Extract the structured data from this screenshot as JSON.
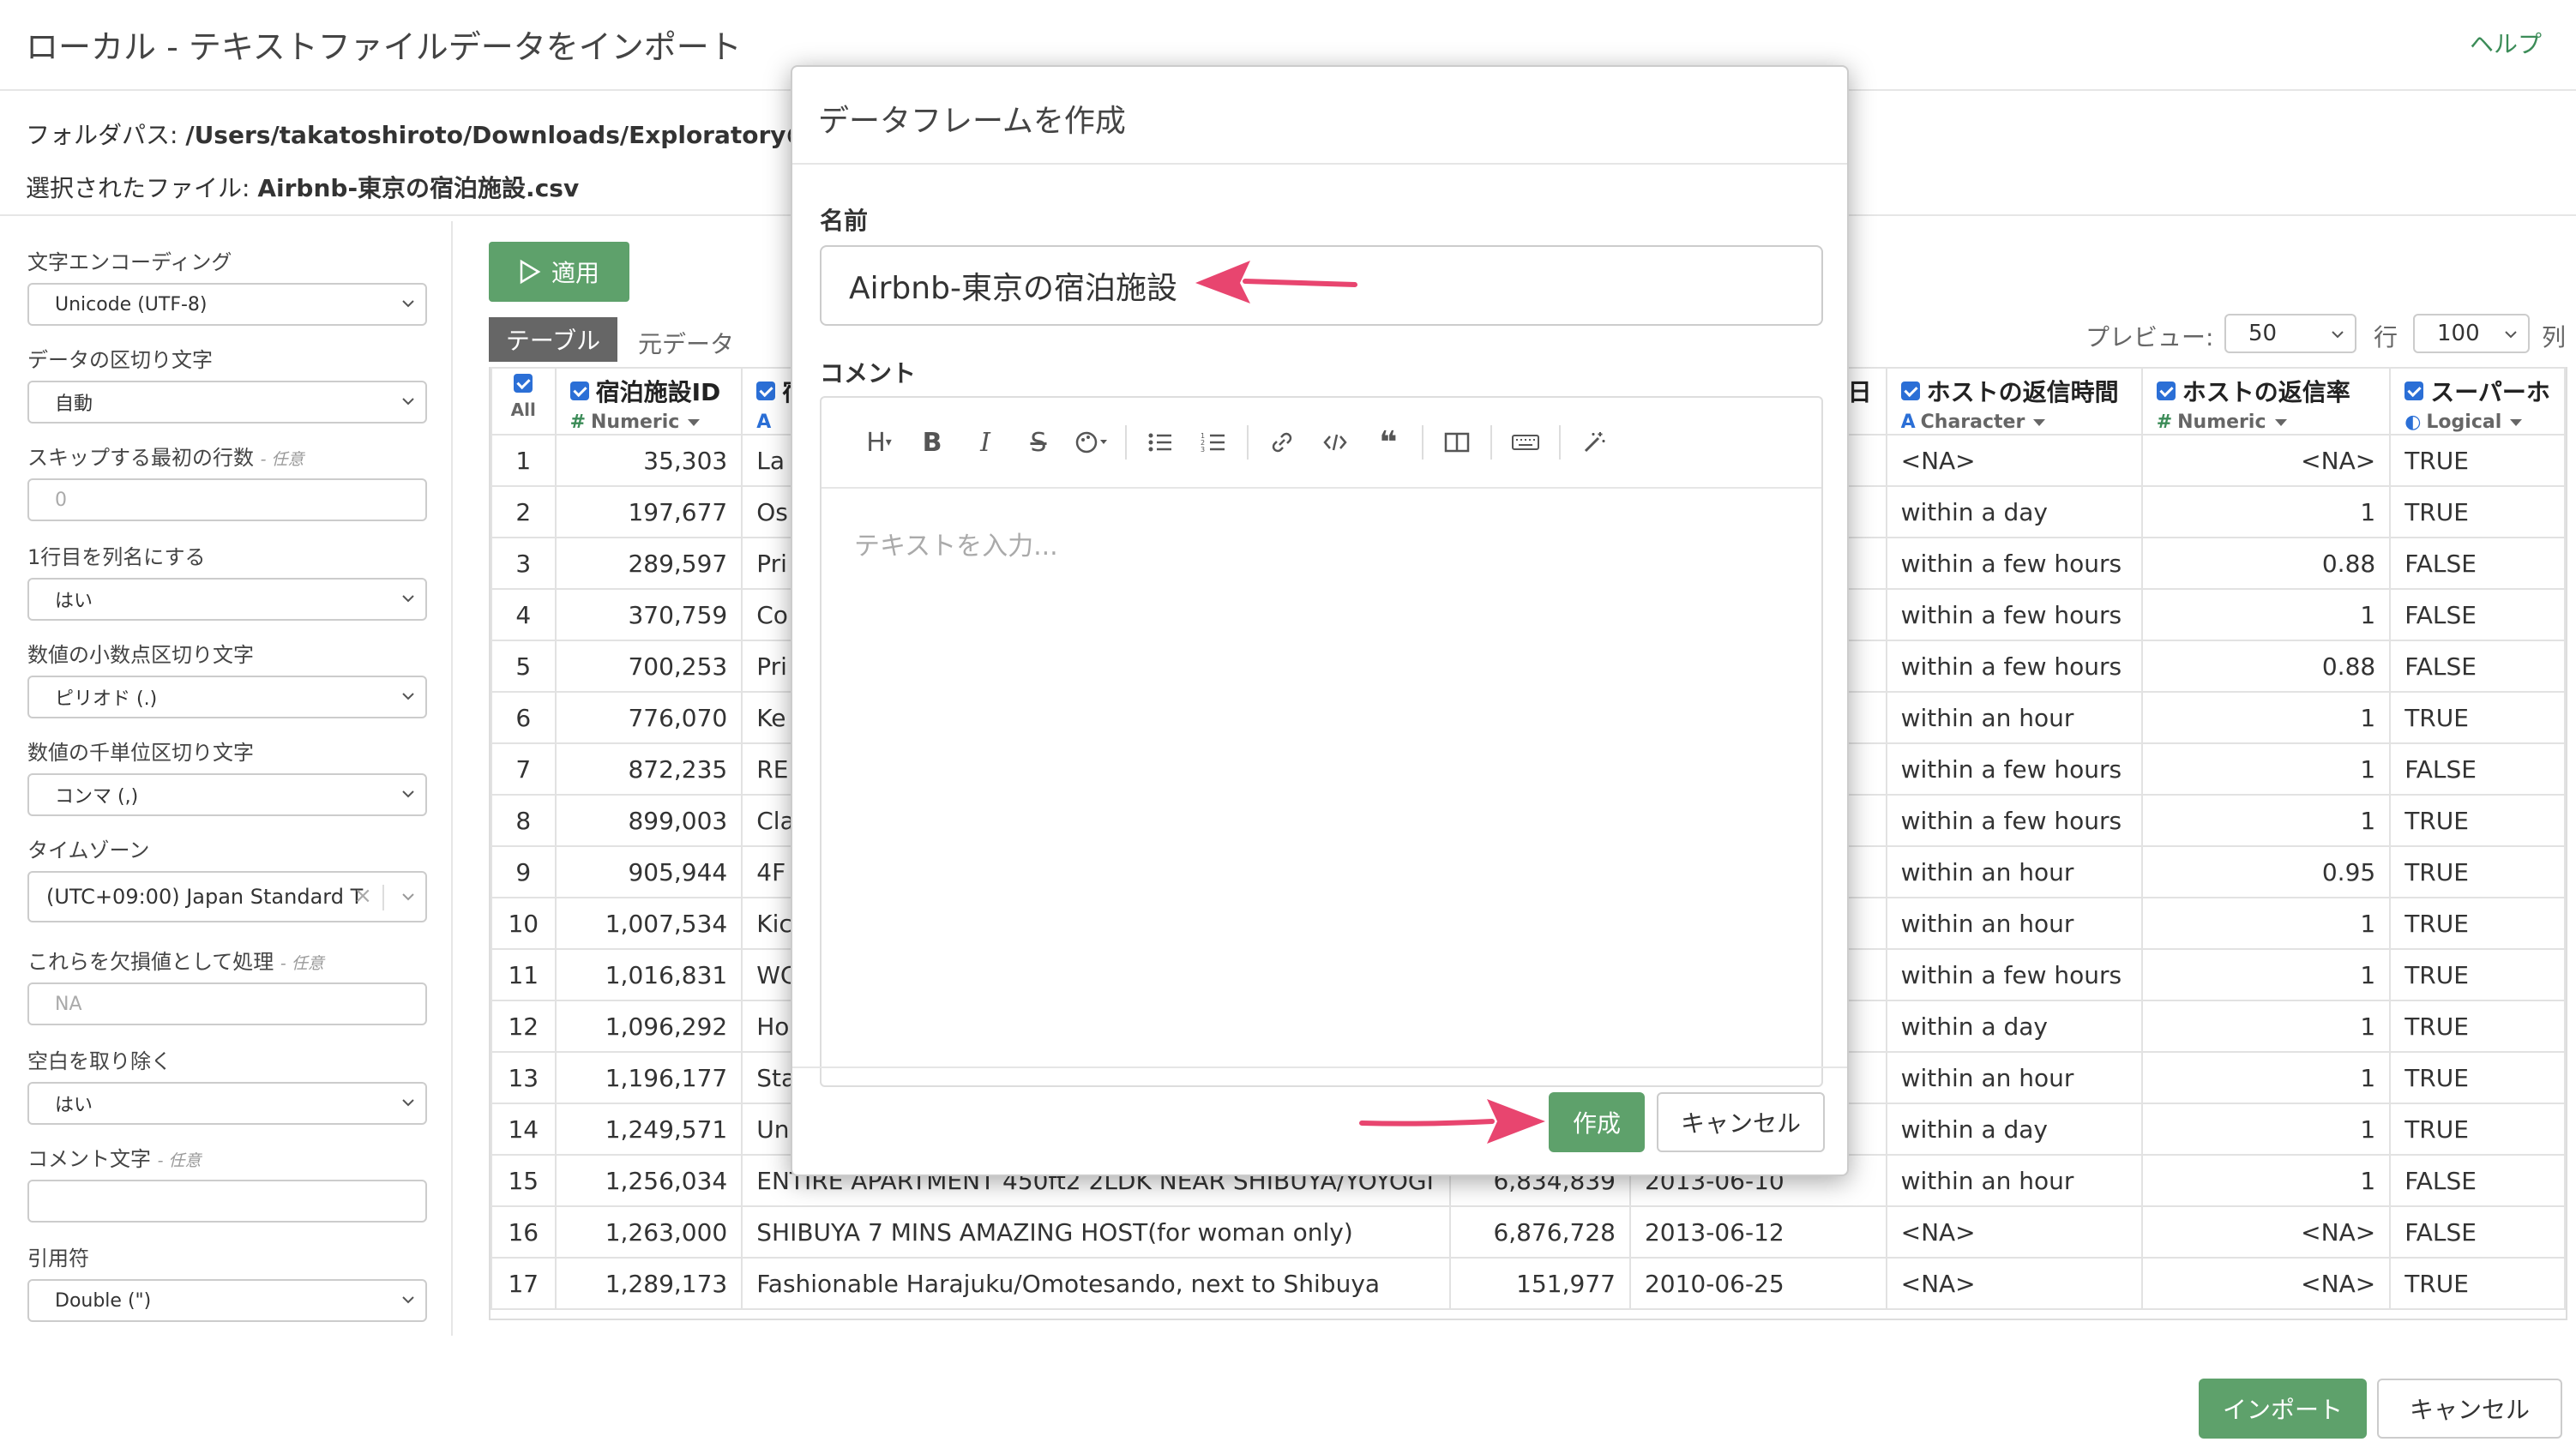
{
  "header": {
    "title": "ローカル - テキストファイルデータをインポート",
    "help_label": "ヘルプ"
  },
  "info": {
    "folder_label": "フォルダパス:",
    "folder_value": "/Users/takatoshiroto/Downloads/Exploratoryの使い",
    "file_label": "選択されたファイル:",
    "file_value": "Airbnb-東京の宿泊施設.csv"
  },
  "sidebar": {
    "encoding": {
      "label": "文字エンコーディング",
      "value": "Unicode (UTF-8)"
    },
    "delimiter": {
      "label": "データの区切り文字",
      "value": "自動"
    },
    "skip_rows": {
      "label": "スキップする最初の行数",
      "optional": "- 任意",
      "placeholder": "0"
    },
    "header_row": {
      "label": "1行目を列名にする",
      "value": "はい"
    },
    "decimal_mark": {
      "label": "数値の小数点区切り文字",
      "value": "ピリオド (.)"
    },
    "grouping_mark": {
      "label": "数値の千単位区切り文字",
      "value": "コンマ (,)"
    },
    "timezone": {
      "label": "タイムゾーン",
      "value": "(UTC+09:00) Japan Standard T",
      "clear": "×"
    },
    "na_values": {
      "label": "これらを欠損値として処理",
      "optional": "- 任意",
      "placeholder": "NA"
    },
    "trim_ws": {
      "label": "空白を取り除く",
      "value": "はい"
    },
    "comment_char": {
      "label": "コメント文字",
      "optional": "- 任意",
      "value": ""
    },
    "quote": {
      "label": "引用符",
      "value": "Double (\")"
    }
  },
  "toolbar": {
    "apply_label": "適用",
    "tab_table": "テーブル",
    "tab_raw": "元データ",
    "preview_label": "プレビュー:",
    "rows_value": "50",
    "rows_label": "行",
    "cols_value": "100",
    "cols_label": "列"
  },
  "table": {
    "all_label": "All",
    "columns": [
      {
        "name": "宿泊施設ID",
        "type": "Numeric"
      },
      {
        "name": "宿",
        "type": ""
      },
      {
        "name": "",
        "type": ""
      },
      {
        "name": "開始日",
        "type": ""
      },
      {
        "name": "ホストの返信時間",
        "type": "Character"
      },
      {
        "name": "ホストの返信率",
        "type": "Numeric"
      },
      {
        "name": "スーパーホ",
        "type": "Logical"
      }
    ],
    "rows": [
      [
        "1",
        "35,303",
        "La",
        "",
        "",
        "<NA>",
        "<NA>",
        "TRUE"
      ],
      [
        "2",
        "197,677",
        "Os",
        "",
        "",
        "within a day",
        "1",
        "TRUE"
      ],
      [
        "3",
        "289,597",
        "Pri",
        "",
        "",
        "within a few hours",
        "0.88",
        "FALSE"
      ],
      [
        "4",
        "370,759",
        "Co",
        "",
        "",
        "within a few hours",
        "1",
        "FALSE"
      ],
      [
        "5",
        "700,253",
        "Pri",
        "",
        "",
        "within a few hours",
        "0.88",
        "FALSE"
      ],
      [
        "6",
        "776,070",
        "Ke",
        "",
        "",
        "within an hour",
        "1",
        "TRUE"
      ],
      [
        "7",
        "872,235",
        "RE",
        "",
        "",
        "within a few hours",
        "1",
        "FALSE"
      ],
      [
        "8",
        "899,003",
        "Cla",
        "",
        "",
        "within a few hours",
        "1",
        "TRUE"
      ],
      [
        "9",
        "905,944",
        "4F",
        "",
        "",
        "within an hour",
        "0.95",
        "TRUE"
      ],
      [
        "10",
        "1,007,534",
        "Kic",
        "",
        "",
        "within an hour",
        "1",
        "TRUE"
      ],
      [
        "11",
        "1,016,831",
        "WC",
        "",
        "",
        "within a few hours",
        "1",
        "TRUE"
      ],
      [
        "12",
        "1,096,292",
        "Ho",
        "",
        "",
        "within a day",
        "1",
        "TRUE"
      ],
      [
        "13",
        "1,196,177",
        "Sta",
        "",
        "",
        "within an hour",
        "1",
        "TRUE"
      ],
      [
        "14",
        "1,249,571",
        "Un",
        "",
        "",
        "within a day",
        "1",
        "TRUE"
      ],
      [
        "15",
        "1,256,034",
        "ENTIRE APARTMENT 450ft2 2LDK NEAR SHIBUYA/YOYOGI",
        "6,834,839",
        "2013-06-10",
        "within an hour",
        "1",
        "FALSE"
      ],
      [
        "16",
        "1,263,000",
        "SHIBUYA 7 MINS AMAZING HOST(for woman only)",
        "6,876,728",
        "2013-06-12",
        "<NA>",
        "<NA>",
        "FALSE"
      ],
      [
        "17",
        "1,289,173",
        "Fashionable Harajuku/Omotesando, next to Shibuya",
        "151,977",
        "2010-06-25",
        "<NA>",
        "<NA>",
        "TRUE"
      ]
    ]
  },
  "footer": {
    "import_label": "インポート",
    "cancel_label": "キャンセル"
  },
  "modal": {
    "title": "データフレームを作成",
    "name_label": "名前",
    "name_value": "Airbnb-東京の宿泊施設",
    "comment_label": "コメント",
    "editor_placeholder": "テキストを入力...",
    "create_label": "作成",
    "cancel_label": "キャンセル",
    "toolbar_icons": [
      "heading-icon",
      "bold-icon",
      "italic-icon",
      "strikethrough-icon",
      "color-palette-icon",
      "bullet-list-icon",
      "numbered-list-icon",
      "link-icon",
      "code-icon",
      "quote-icon",
      "split-view-icon",
      "keyboard-icon",
      "magic-wand-icon"
    ]
  },
  "colors": {
    "accent_green": "#5ea16b",
    "arrow_pink": "#e8456f",
    "checkbox_blue": "#2b6fd6"
  }
}
